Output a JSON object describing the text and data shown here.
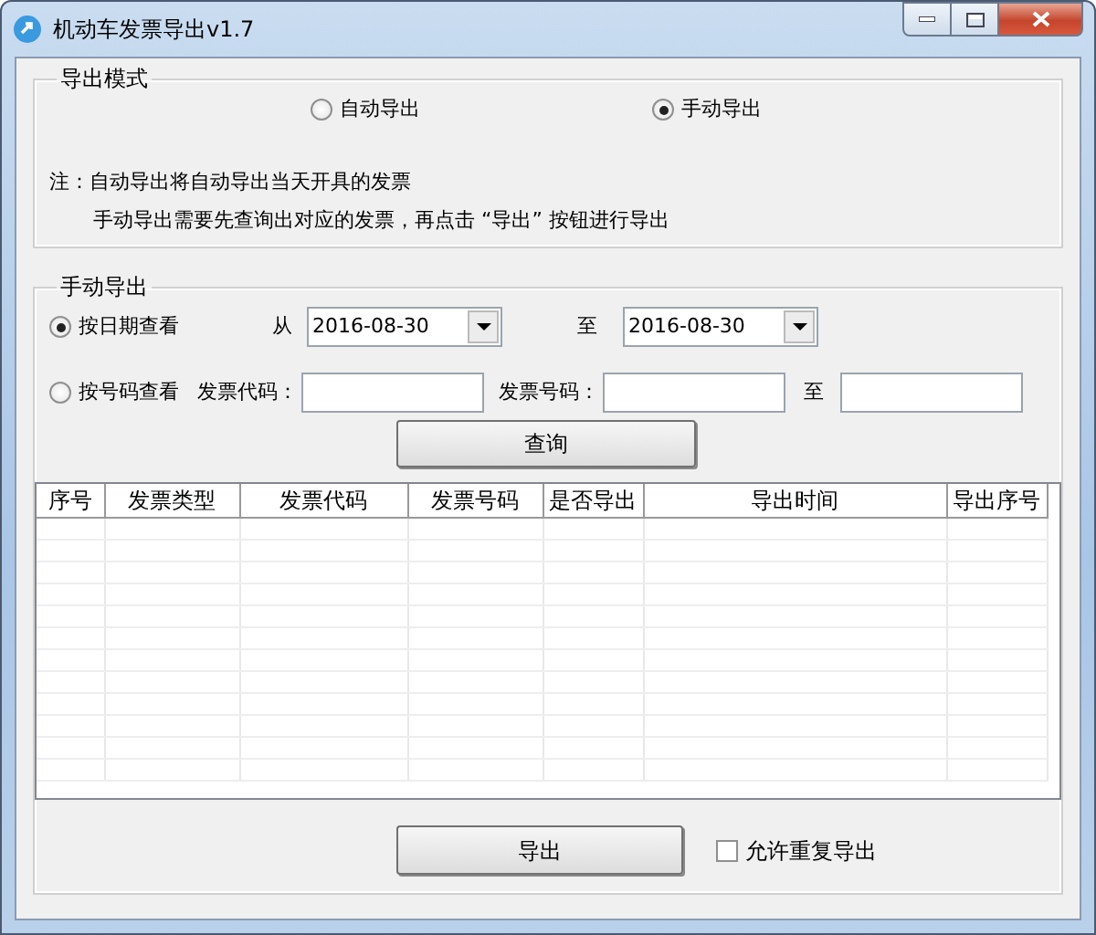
{
  "window": {
    "title": "机动车发票导出v1.7"
  },
  "export_mode": {
    "title": "导出模式",
    "options": [
      {
        "label": "自动导出",
        "selected": false
      },
      {
        "label": "手动导出",
        "selected": true
      }
    ],
    "notes": [
      "注：自动导出将自动导出当天开具的发票",
      "手动导出需要先查询出对应的发票，再点击 “导出” 按钮进行导出"
    ]
  },
  "manual": {
    "title": "手动导出",
    "query_modes": [
      {
        "label": "按日期查看",
        "selected": true
      },
      {
        "label": "按号码查看",
        "selected": false
      }
    ],
    "date_from_label": "从",
    "date_from": "2016-08-30",
    "date_to_label": "至",
    "date_to": "2016-08-30",
    "code_label": "发票代码：",
    "number_label": "发票号码：",
    "number_to_label": "至",
    "query_button": "查询"
  },
  "table": {
    "columns": [
      "序号",
      "发票类型",
      "发票代码",
      "发票号码",
      "是否导出",
      "导出时间",
      "导出序号"
    ]
  },
  "export_button": "导出",
  "allow_duplicate": {
    "label": "允许重复导出",
    "checked": false
  }
}
